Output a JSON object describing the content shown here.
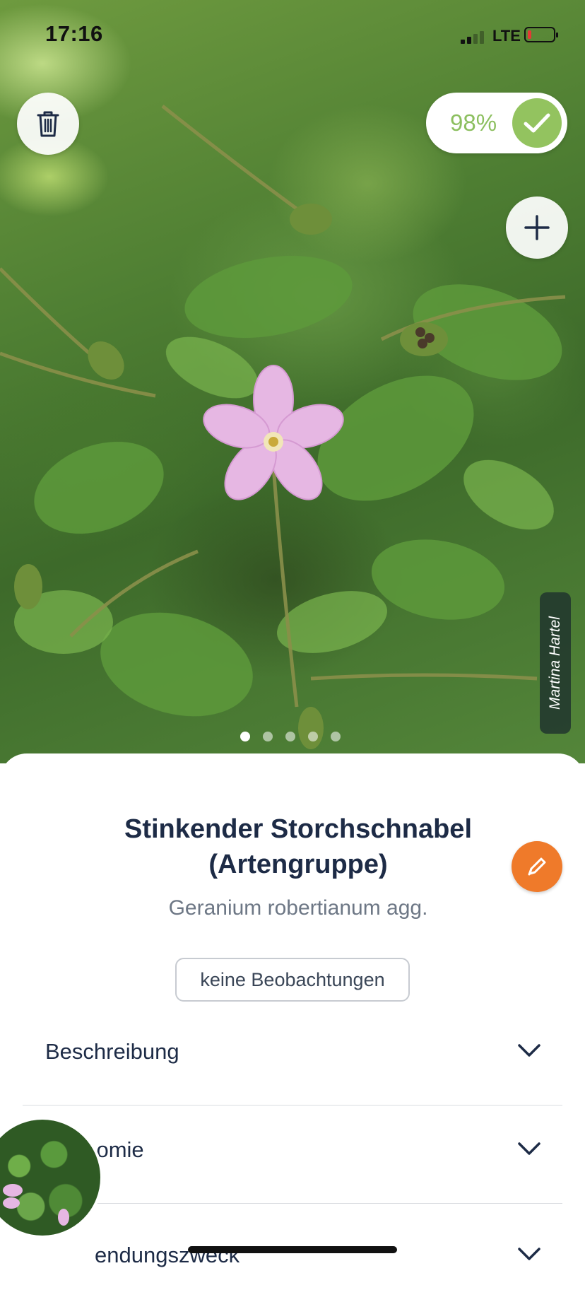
{
  "status_bar": {
    "time": "17:16",
    "network": "LTE"
  },
  "photo": {
    "confidence": "98%",
    "author": "Martina Hartel",
    "page_count": 5,
    "active_page": 0
  },
  "species": {
    "name": "Stinkender Storchschnabel (Artengruppe)",
    "scientific_name": "Geranium robertianum agg.",
    "observations_label": "keine Beobachtungen"
  },
  "sections": [
    {
      "label": "Beschreibung"
    },
    {
      "label": "onomie"
    },
    {
      "label": "endungszweck"
    }
  ],
  "colors": {
    "accent_orange": "#ef7a2a",
    "confidence_green": "#93c35f",
    "title_navy": "#1d2b46"
  },
  "icons": {
    "delete": "trash-icon",
    "confidence": "check-icon",
    "add": "plus-icon",
    "edit": "pencil-icon",
    "expand": "chevron-down-icon"
  }
}
